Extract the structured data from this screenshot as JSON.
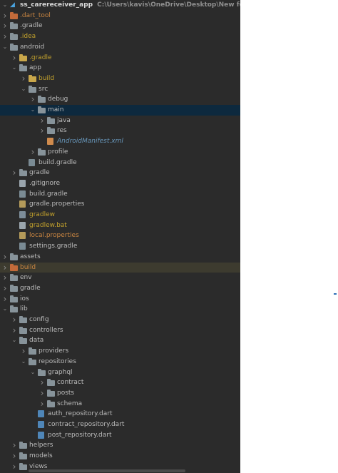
{
  "colors": {
    "panel_bg": "#2b2b2b",
    "text": "#bbbbbb",
    "folder_gray": "#87939a",
    "folder_yellow": "#c9a74b",
    "folder_orange": "#c26a3a",
    "folder_blue": "#5c8fc0",
    "ignored_text": "#c2a12c",
    "excluded_text": "#c98541",
    "link_text": "#6897bb",
    "selected_row": "#0d293e"
  },
  "rows": [
    {
      "label": "ss_carereceiver_app",
      "path": "C:\\Users\\kavis\\OneDrive\\Desktop\\New folder\\care_receive",
      "depth": 0,
      "arrow": "down",
      "icon": "flutter-icon",
      "bold": true
    },
    {
      "label": ".dart_tool",
      "depth": 0,
      "arrow": "right",
      "icon": "folder",
      "color": "orange",
      "text": "excluded"
    },
    {
      "label": ".gradle",
      "depth": 0,
      "arrow": "right",
      "icon": "folder",
      "color": "gray"
    },
    {
      "label": ".idea",
      "depth": 0,
      "arrow": "right",
      "icon": "folder",
      "color": "gray",
      "text": "ignored"
    },
    {
      "label": "android",
      "depth": 0,
      "arrow": "down",
      "icon": "folder",
      "color": "gray"
    },
    {
      "label": ".gradle",
      "depth": 1,
      "arrow": "right",
      "icon": "folder",
      "color": "yellow",
      "text": "ignored"
    },
    {
      "label": "app",
      "depth": 1,
      "arrow": "down",
      "icon": "folder",
      "color": "gray"
    },
    {
      "label": "build",
      "depth": 2,
      "arrow": "right",
      "icon": "folder",
      "color": "yellow",
      "text": "ignored"
    },
    {
      "label": "src",
      "depth": 2,
      "arrow": "down",
      "icon": "folder",
      "color": "gray"
    },
    {
      "label": "debug",
      "depth": 3,
      "arrow": "right",
      "icon": "folder",
      "color": "gray"
    },
    {
      "label": "main",
      "depth": 3,
      "arrow": "down",
      "icon": "folder",
      "color": "gray",
      "selected": true
    },
    {
      "label": "java",
      "depth": 4,
      "arrow": "right",
      "icon": "folder",
      "color": "gray"
    },
    {
      "label": "res",
      "depth": 4,
      "arrow": "right",
      "icon": "folder",
      "color": "gray"
    },
    {
      "label": "AndroidManifest.xml",
      "depth": 4,
      "arrow": "none",
      "icon": "xml-file",
      "text": "link"
    },
    {
      "label": "profile",
      "depth": 3,
      "arrow": "right",
      "icon": "folder",
      "color": "gray"
    },
    {
      "label": "build.gradle",
      "depth": 2,
      "arrow": "none",
      "icon": "gradle-file"
    },
    {
      "label": "gradle",
      "depth": 1,
      "arrow": "right",
      "icon": "folder",
      "color": "gray"
    },
    {
      "label": ".gitignore",
      "depth": 1,
      "arrow": "none",
      "icon": "text-file"
    },
    {
      "label": "build.gradle",
      "depth": 1,
      "arrow": "none",
      "icon": "gradle-file"
    },
    {
      "label": "gradle.properties",
      "depth": 1,
      "arrow": "none",
      "icon": "properties-file"
    },
    {
      "label": "gradlew",
      "depth": 1,
      "arrow": "none",
      "icon": "script-file",
      "text": "ignored"
    },
    {
      "label": "gradlew.bat",
      "depth": 1,
      "arrow": "none",
      "icon": "text-file",
      "text": "ignored"
    },
    {
      "label": "local.properties",
      "depth": 1,
      "arrow": "none",
      "icon": "properties-file",
      "text": "excluded"
    },
    {
      "label": "settings.gradle",
      "depth": 1,
      "arrow": "none",
      "icon": "gradle-file"
    },
    {
      "label": "assets",
      "depth": 0,
      "arrow": "right",
      "icon": "folder",
      "color": "gray"
    },
    {
      "label": "build",
      "depth": 0,
      "arrow": "right",
      "icon": "folder",
      "color": "orange",
      "text": "excluded",
      "highlight": true
    },
    {
      "label": "env",
      "depth": 0,
      "arrow": "right",
      "icon": "folder",
      "color": "gray"
    },
    {
      "label": "gradle",
      "depth": 0,
      "arrow": "right",
      "icon": "folder",
      "color": "gray"
    },
    {
      "label": "ios",
      "depth": 0,
      "arrow": "right",
      "icon": "folder",
      "color": "gray"
    },
    {
      "label": "lib",
      "depth": 0,
      "arrow": "down",
      "icon": "folder",
      "color": "gray"
    },
    {
      "label": "config",
      "depth": 1,
      "arrow": "right",
      "icon": "folder",
      "color": "gray"
    },
    {
      "label": "controllers",
      "depth": 1,
      "arrow": "right",
      "icon": "folder",
      "color": "gray"
    },
    {
      "label": "data",
      "depth": 1,
      "arrow": "down",
      "icon": "folder",
      "color": "gray"
    },
    {
      "label": "providers",
      "depth": 2,
      "arrow": "right",
      "icon": "folder",
      "color": "gray"
    },
    {
      "label": "repositories",
      "depth": 2,
      "arrow": "down",
      "icon": "folder",
      "color": "gray"
    },
    {
      "label": "graphql",
      "depth": 3,
      "arrow": "down",
      "icon": "folder",
      "color": "gray"
    },
    {
      "label": "contract",
      "depth": 4,
      "arrow": "right",
      "icon": "folder",
      "color": "gray"
    },
    {
      "label": "posts",
      "depth": 4,
      "arrow": "right",
      "icon": "folder",
      "color": "gray"
    },
    {
      "label": "schema",
      "depth": 4,
      "arrow": "right",
      "icon": "folder",
      "color": "gray"
    },
    {
      "label": "auth_repository.dart",
      "depth": 3,
      "arrow": "none",
      "icon": "dart-file"
    },
    {
      "label": "contract_repository.dart",
      "depth": 3,
      "arrow": "none",
      "icon": "dart-file"
    },
    {
      "label": "post_repository.dart",
      "depth": 3,
      "arrow": "none",
      "icon": "dart-file"
    },
    {
      "label": "helpers",
      "depth": 1,
      "arrow": "right",
      "icon": "folder",
      "color": "gray"
    },
    {
      "label": "models",
      "depth": 1,
      "arrow": "right",
      "icon": "folder",
      "color": "gray"
    },
    {
      "label": "views",
      "depth": 1,
      "arrow": "right",
      "icon": "folder",
      "color": "gray"
    }
  ]
}
